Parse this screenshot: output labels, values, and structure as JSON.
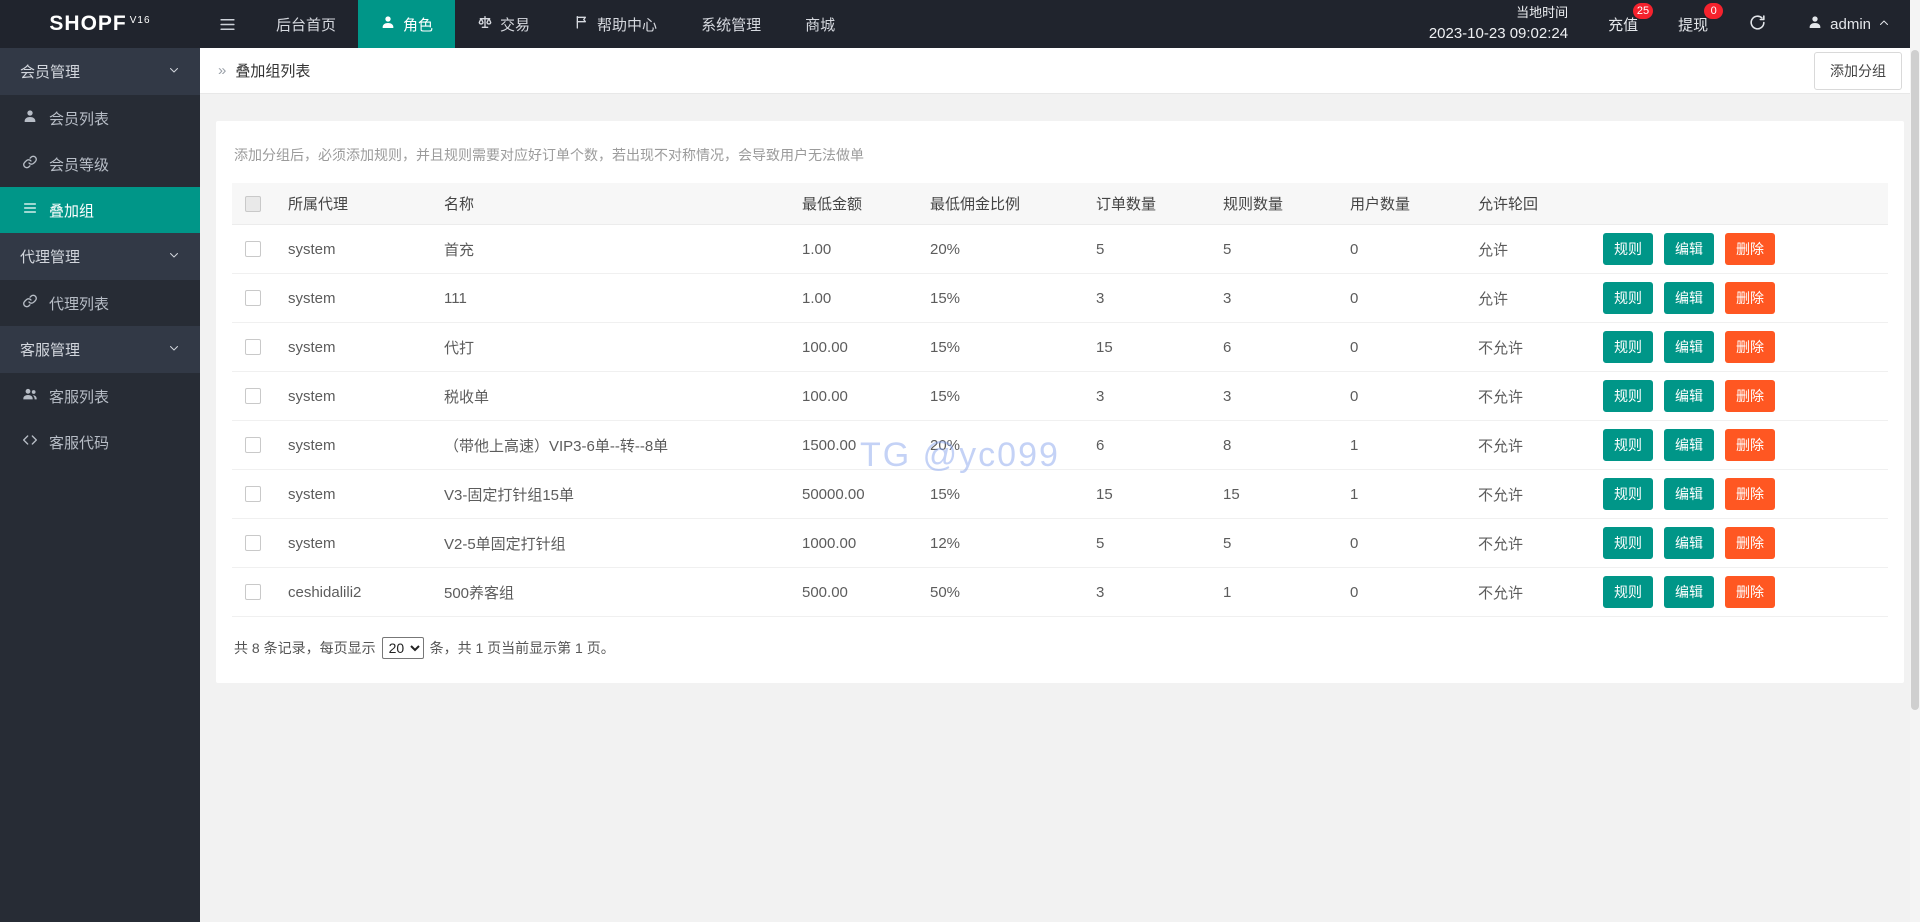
{
  "app": {
    "logo": "SHOPF",
    "logo_sup": "V16"
  },
  "navbar": {
    "items": [
      {
        "label": "后台首页",
        "icon": "",
        "active": false
      },
      {
        "label": "角色",
        "icon": "user-icon",
        "active": true
      },
      {
        "label": "交易",
        "icon": "scales-icon",
        "active": false
      },
      {
        "label": "帮助中心",
        "icon": "flag-icon",
        "active": false
      },
      {
        "label": "系统管理",
        "icon": "",
        "active": false
      },
      {
        "label": "商城",
        "icon": "",
        "active": false
      }
    ],
    "time_label": "当地时间",
    "time_value": "2023-10-23 09:02:24",
    "recharge": {
      "label": "充值",
      "badge": "25"
    },
    "withdraw": {
      "label": "提现",
      "badge": "0"
    },
    "user": "admin"
  },
  "sidebar": {
    "items": [
      {
        "type": "group",
        "label": "会员管理",
        "icon": "chevron-down-icon"
      },
      {
        "type": "item",
        "label": "会员列表",
        "icon": "user-icon"
      },
      {
        "type": "item",
        "label": "会员等级",
        "icon": "link-icon"
      },
      {
        "type": "item",
        "label": "叠加组",
        "icon": "list-icon",
        "active": true
      },
      {
        "type": "group",
        "label": "代理管理",
        "icon": "chevron-down-icon"
      },
      {
        "type": "item",
        "label": "代理列表",
        "icon": "link-icon"
      },
      {
        "type": "group",
        "label": "客服管理",
        "icon": "chevron-down-icon"
      },
      {
        "type": "item",
        "label": "客服列表",
        "icon": "users-icon"
      },
      {
        "type": "item",
        "label": "客服代码",
        "icon": "code-icon"
      }
    ]
  },
  "breadcrumb": {
    "title": "叠加组列表",
    "add_button": "添加分组"
  },
  "main": {
    "hint": "添加分组后，必须添加规则，并且规则需要对应好订单个数，若出现不对称情况，会导致用户无法做单",
    "watermark": "TG @yc099"
  },
  "table": {
    "headers": [
      "所属代理",
      "名称",
      "最低金额",
      "最低佣金比例",
      "订单数量",
      "规则数量",
      "用户数量",
      "允许轮回"
    ],
    "actions": {
      "rule": "规则",
      "edit": "编辑",
      "delete": "删除"
    },
    "rows": [
      {
        "agent": "system",
        "name": "首充",
        "min_amount": "1.00",
        "commission": "20%",
        "orders": "5",
        "rules": "5",
        "users": "0",
        "loop": "允许"
      },
      {
        "agent": "system",
        "name": "111",
        "min_amount": "1.00",
        "commission": "15%",
        "orders": "3",
        "rules": "3",
        "users": "0",
        "loop": "允许"
      },
      {
        "agent": "system",
        "name": "代打",
        "min_amount": "100.00",
        "commission": "15%",
        "orders": "15",
        "rules": "6",
        "users": "0",
        "loop": "不允许"
      },
      {
        "agent": "system",
        "name": "税收单",
        "min_amount": "100.00",
        "commission": "15%",
        "orders": "3",
        "rules": "3",
        "users": "0",
        "loop": "不允许"
      },
      {
        "agent": "system",
        "name": "（带他上高速）VIP3-6单--转--8单",
        "min_amount": "1500.00",
        "commission": "20%",
        "orders": "6",
        "rules": "8",
        "users": "1",
        "loop": "不允许"
      },
      {
        "agent": "system",
        "name": "V3-固定打针组15单",
        "min_amount": "50000.00",
        "commission": "15%",
        "orders": "15",
        "rules": "15",
        "users": "1",
        "loop": "不允许"
      },
      {
        "agent": "system",
        "name": "V2-5单固定打针组",
        "min_amount": "1000.00",
        "commission": "12%",
        "orders": "5",
        "rules": "5",
        "users": "0",
        "loop": "不允许"
      },
      {
        "agent": "ceshidalili2",
        "name": "500养客组",
        "min_amount": "500.00",
        "commission": "50%",
        "orders": "3",
        "rules": "1",
        "users": "0",
        "loop": "不允许"
      }
    ],
    "footer": {
      "prefix": "共 8 条记录，每页显示",
      "page_size": "20",
      "suffix": "条，共 1 页当前显示第 1 页。"
    }
  },
  "colors": {
    "teal": "#009688",
    "orange": "#ff5722",
    "badge_red": "#f5222d",
    "topbar": "#20242d",
    "sidebar": "#272c35"
  }
}
